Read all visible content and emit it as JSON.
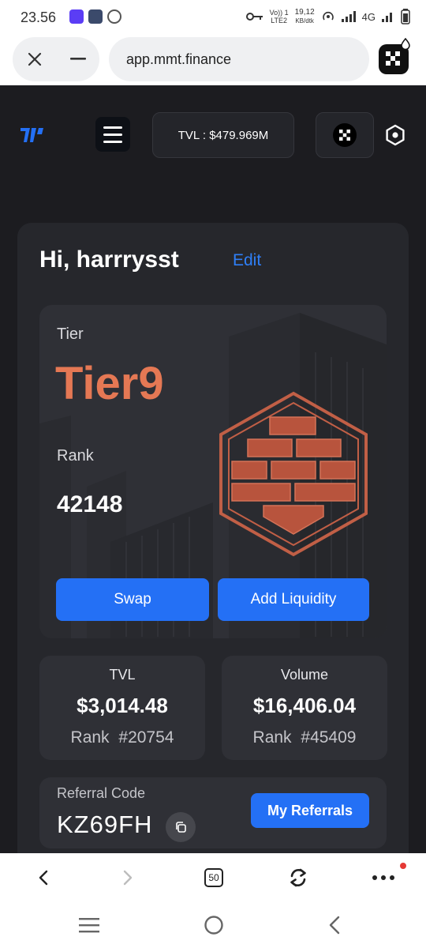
{
  "status_bar": {
    "time": "23.56",
    "volte_top": "Vo)) 1",
    "volte_bottom": "LTE2",
    "speed_value": "19,12",
    "speed_unit": "KB/dtk",
    "network": "4G"
  },
  "browser": {
    "url": "app.mmt.finance",
    "tab_count": "50"
  },
  "header": {
    "tvl_label": "TVL : $479.969M"
  },
  "profile": {
    "greeting": "Hi, harrrysst",
    "edit_label": "Edit"
  },
  "tier_card": {
    "tier_label": "Tier",
    "tier_value": "Tier9",
    "rank_label": "Rank",
    "rank_value": "42148",
    "swap_label": "Swap",
    "add_liquidity_label": "Add Liquidity"
  },
  "stats": {
    "tvl": {
      "title": "TVL",
      "amount": "$3,014.48",
      "rank": "Rank #20754"
    },
    "volume": {
      "title": "Volume",
      "amount": "$16,406.04",
      "rank": "Rank #45409"
    }
  },
  "referral": {
    "label": "Referral Code",
    "code": "KZ69FH",
    "button_label": "My Referrals"
  },
  "colors": {
    "accent_blue": "#2470f5",
    "tier_orange": "#e57854",
    "panel_bg": "#26272c",
    "app_bg": "#1c1c20"
  },
  "icons": [
    "close-icon",
    "minimize-icon",
    "okx-icon",
    "hamburger-icon",
    "settings-icon",
    "copy-icon",
    "back-icon",
    "forward-icon",
    "refresh-icon",
    "more-icon",
    "recents-icon",
    "home-icon",
    "nav-back-icon"
  ]
}
